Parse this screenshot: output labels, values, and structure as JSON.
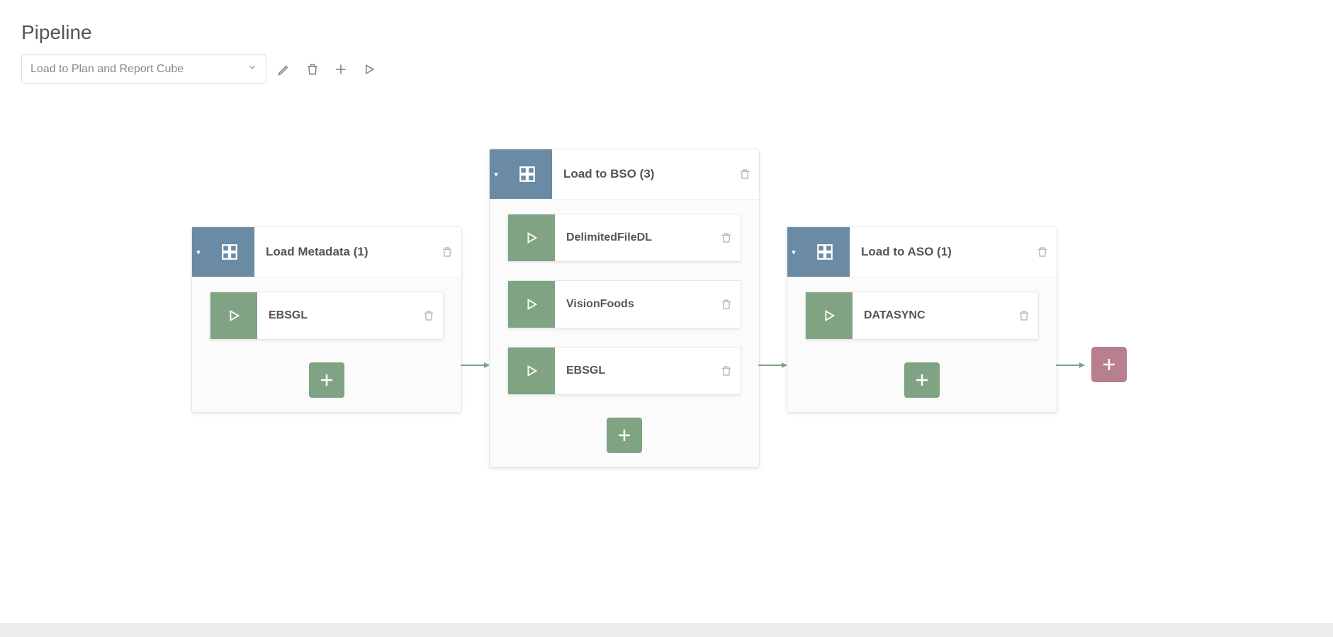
{
  "page_title": "Pipeline",
  "toolbar": {
    "select_label": "Load to Plan and Report Cube"
  },
  "colors": {
    "stage_header": "#6a8ba3",
    "job_run": "#7fa383",
    "add_stage": "#b87f8f"
  },
  "stages": [
    {
      "title": "Load Metadata (1)",
      "jobs": [
        {
          "name": "EBSGL"
        }
      ]
    },
    {
      "title": "Load to BSO (3)",
      "jobs": [
        {
          "name": "DelimitedFileDL"
        },
        {
          "name": "VisionFoods"
        },
        {
          "name": "EBSGL"
        }
      ]
    },
    {
      "title": "Load to ASO (1)",
      "jobs": [
        {
          "name": "DATASYNC"
        }
      ]
    }
  ]
}
